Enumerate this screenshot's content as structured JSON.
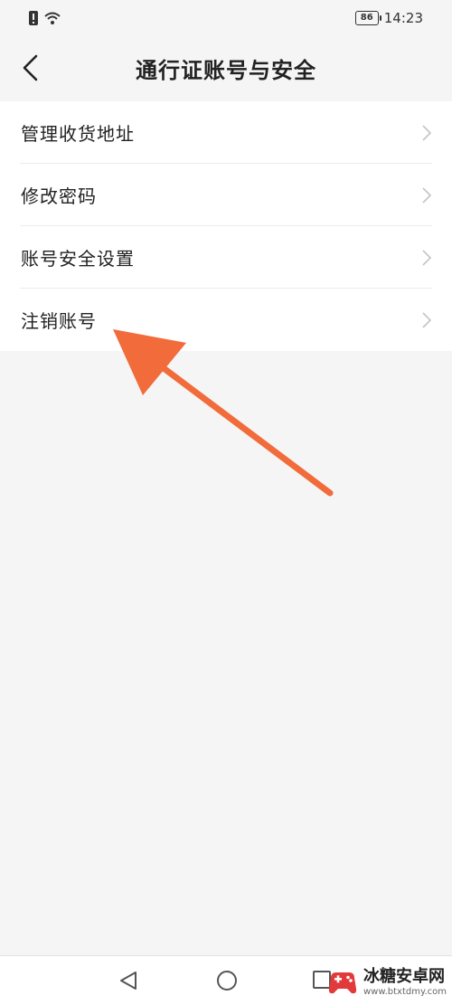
{
  "status_bar": {
    "battery": "86",
    "time": "14:23"
  },
  "header": {
    "title": "通行证账号与安全"
  },
  "menu": {
    "items": [
      {
        "label": "管理收货地址"
      },
      {
        "label": "修改密码"
      },
      {
        "label": "账号安全设置"
      },
      {
        "label": "注销账号"
      }
    ]
  },
  "annotation": {
    "arrow_color": "#f26b3a"
  },
  "watermark": {
    "name": "冰糖安卓网",
    "url": "www.btxtdmy.com"
  }
}
